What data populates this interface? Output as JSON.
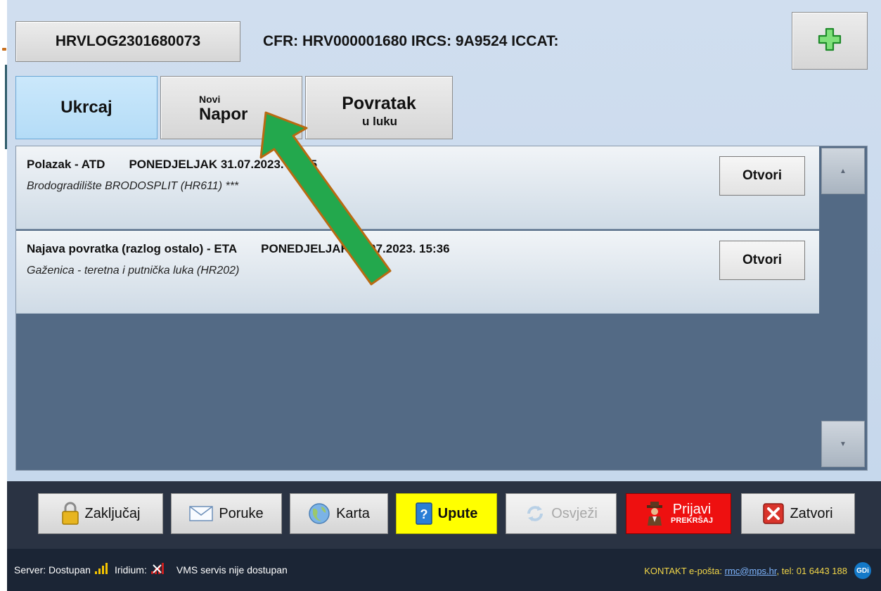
{
  "header": {
    "logbook_id": "HRVLOG2301680073",
    "vessel_info": "CFR: HRV000001680  IRCS: 9A9524  ICCAT:",
    "add_icon": "plus-icon"
  },
  "tabs": {
    "ukrcaj": "Ukrcaj",
    "novi_small": "Novi",
    "novi_big": "Napor",
    "povratak_big": "Povratak",
    "povratak_small": "u luku"
  },
  "entries": [
    {
      "event": "Polazak - ATD",
      "datetime": "PONEDJELJAK 31.07.2023. 11:35",
      "location": "Brodogradilište BRODOSPLIT (HR611) ***",
      "button": "Otvori"
    },
    {
      "event": "Najava povratka (razlog ostalo) - ETA",
      "datetime": "PONEDJELJAK 31.07.2023. 15:36",
      "location": "Gaženica - teretna i putnička luka (HR202)",
      "button": "Otvori"
    }
  ],
  "toolbar": {
    "lock": "Zaključaj",
    "messages": "Poruke",
    "map": "Karta",
    "help": "Upute",
    "refresh": "Osvježi",
    "report_main": "Prijavi",
    "report_sub": "PREKRŠAJ",
    "close": "Zatvori"
  },
  "status": {
    "server_label": "Server:",
    "server_value": "Dostupan",
    "iridium_label": "Iridium:",
    "vms": "VMS servis nije dostupan",
    "contact_prefix": "KONTAKT e-pošta:",
    "email": "rmc@mps.hr",
    "phone": ", tel: 01 6443 188",
    "badge": "GDi"
  },
  "colors": {
    "accent_green": "#1fa34a",
    "help_yellow": "#ffff00",
    "report_red": "#ee1010"
  }
}
